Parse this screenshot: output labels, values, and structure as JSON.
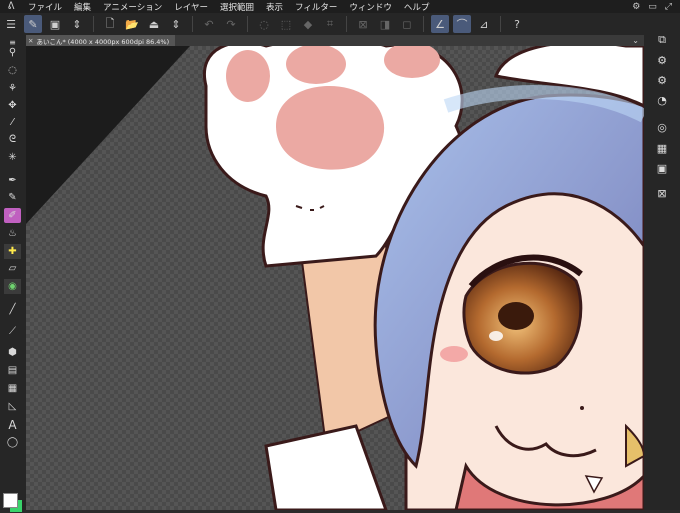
{
  "menu": {
    "items": [
      "ファイル",
      "編集",
      "アニメーション",
      "レイヤー",
      "選択範囲",
      "表示",
      "フィルター",
      "ウィンドウ",
      "ヘルプ"
    ]
  },
  "tab": {
    "title": "あいこん* (4000 x 4000px 600dpi 86.4%)"
  },
  "colors": {
    "foreground": "#ffffff",
    "background": "#39d36b",
    "active_tool": "#c060c0"
  },
  "icons": {
    "app": "clip-studio-logo-icon",
    "menu": "hamburger-icon"
  }
}
